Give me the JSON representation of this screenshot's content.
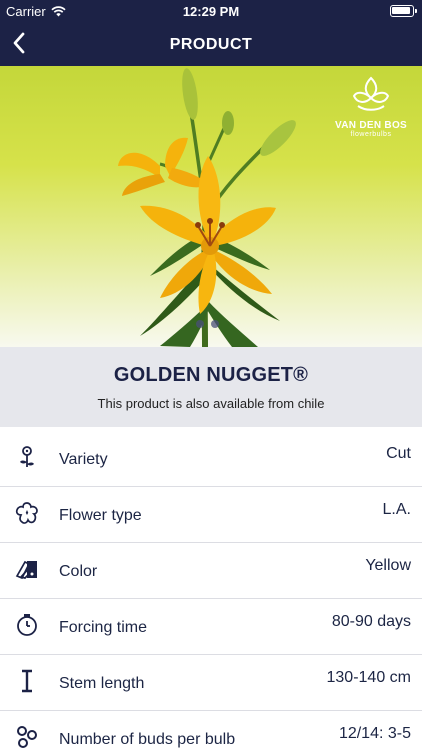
{
  "status_bar": {
    "carrier": "Carrier",
    "time": "12:29 PM"
  },
  "nav": {
    "title": "PRODUCT",
    "back_icon": "chevron-left-icon"
  },
  "brand": {
    "name": "VAN DEN BOS",
    "tagline": "flowerbulbs",
    "logo_icon": "lotus-logo"
  },
  "gallery": {
    "page_count": 2,
    "current_page": 1
  },
  "product": {
    "name": "GOLDEN NUGGET®",
    "availability_note": "This product is also available from chile"
  },
  "specs": [
    {
      "label": "Variety",
      "value": "Cut",
      "icon": "flower-sprout-icon"
    },
    {
      "label": "Flower type",
      "value": "L.A.",
      "icon": "flower-outline-icon"
    },
    {
      "label": "Color",
      "value": "Yellow",
      "icon": "color-swatch-icon"
    },
    {
      "label": "Forcing time",
      "value": "80-90 days",
      "icon": "stopwatch-icon"
    },
    {
      "label": "Stem length",
      "value": "130-140 cm",
      "icon": "stem-length-icon"
    },
    {
      "label": "Number of buds per bulb",
      "value": "12/14: 3-5",
      "icon": "buds-icon"
    }
  ],
  "colors": {
    "header": "#1c2246",
    "hero_top": "#c4d73a",
    "petal": "#f5b30c",
    "title_bg": "#e6e7ec"
  }
}
